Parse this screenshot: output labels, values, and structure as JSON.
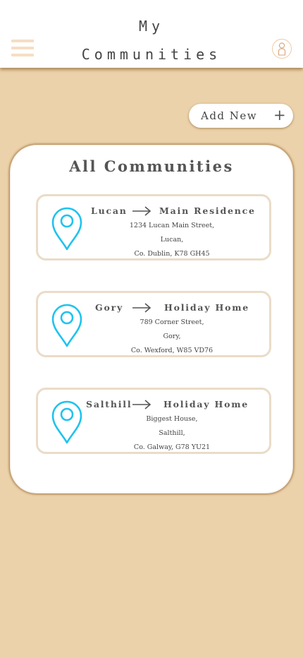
{
  "header": {
    "title_line1": "My",
    "title_line2": "Communities"
  },
  "add_button": {
    "label": "Add New",
    "icon": "+"
  },
  "panel": {
    "title": "All Communities"
  },
  "communities": [
    {
      "name": "Lucan",
      "type": "Main Residence",
      "address_line1": "1234 Lucan Main Street,",
      "address_line2": "Lucan,",
      "address_line3": "Co. Dublin, K78 GH45"
    },
    {
      "name": "Gory",
      "type": "Holiday Home",
      "address_line1": "789 Corner Street,",
      "address_line2": "Gory,",
      "address_line3": "Co. Wexford, W85 VD76"
    },
    {
      "name": "Salthill",
      "type": "Holiday Home",
      "address_line1": "Biggest House,",
      "address_line2": "Salthill,",
      "address_line3": "Co. Galway, G78 YU21"
    }
  ],
  "colors": {
    "background": "#ebd2aa",
    "pin": "#1fc3ee",
    "card_border": "#eadcc8",
    "menu": "#f6ddc4"
  },
  "icons": {
    "menu": "hamburger-icon",
    "profile": "avatar-icon",
    "pin": "location-pin-icon",
    "arrow": "arrow-right-icon",
    "add": "plus-icon"
  }
}
